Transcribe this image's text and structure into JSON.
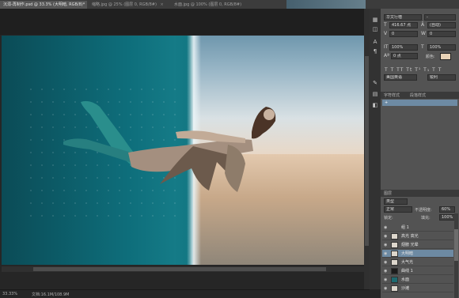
{
  "tabs": [
    {
      "label": "沉溺-再制作.psd @ 33.3% (大明暗, RGB/8)*",
      "close": "×"
    },
    {
      "label": "缩略.jpg @ 25% (图层 0, RGB/8#)",
      "close": "×"
    },
    {
      "label": "水面.jpg @ 100% (图层 0, RGB/8#)",
      "close": "×"
    }
  ],
  "character_panel": {
    "font_family": "华文行楷",
    "font_style": "-",
    "font_size": "416.67 点",
    "leading": "(自动)",
    "tracking": "0",
    "kerning": "0",
    "vscale": "100%",
    "hscale": "100%",
    "baseline": "0 点",
    "color_label": "颜色:",
    "typo_buttons": "T T TT Tt T¹ T₁ T T",
    "language": "美国英语",
    "aa": "锐利",
    "swatch_color": "#e8d2b6",
    "tab_char": "字符",
    "tab_para": "段落"
  },
  "paragraph_styles": {
    "tab_styles": "字符样式",
    "tab_para_styles": "段落样式",
    "selected_item": "+"
  },
  "layers": {
    "tab": "图层",
    "filter_kind": "类型",
    "blend_mode": "正常",
    "opacity_label": "不透明度:",
    "opacity": "60%",
    "lock_label": "锁定:",
    "fill_label": "填充:",
    "fill": "100%",
    "rows": [
      {
        "name": "组 1"
      },
      {
        "name": "高光 高光"
      },
      {
        "name": "翅膀 光晕"
      },
      {
        "name": "大明暗"
      },
      {
        "name": "大气光"
      },
      {
        "name": "曲线 1"
      },
      {
        "name": "水面"
      },
      {
        "name": "沙滩"
      }
    ]
  },
  "status": {
    "zoom": "33.33%",
    "doc": "文档:16.1M/108.9M"
  }
}
